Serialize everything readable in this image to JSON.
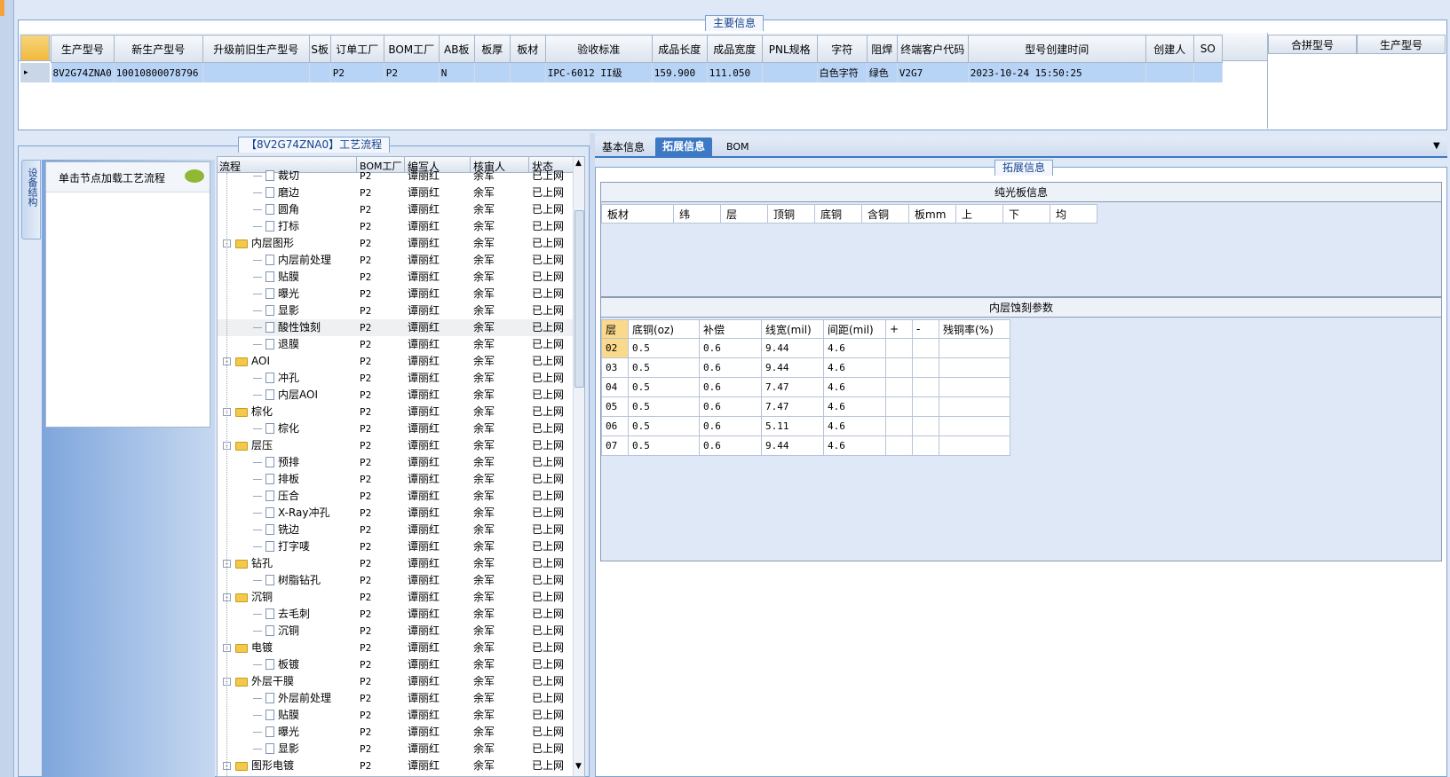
{
  "main_info": {
    "title": "主要信息",
    "columns": [
      "生产型号",
      "新生产型号",
      "升级前旧生产型号",
      "S板",
      "订单工厂",
      "BOM工厂",
      "AB板",
      "板厚",
      "板材",
      "验收标准",
      "成品长度",
      "成品宽度",
      "PNL规格",
      "字符",
      "阻焊",
      "终端客户代码",
      "型号创建时间",
      "创建人",
      "SO"
    ],
    "row": [
      "8V2G74ZNA0",
      "10010800078796",
      "",
      "",
      "P2",
      "P2",
      "N",
      "",
      "",
      "IPC-6012 II级",
      "159.900",
      "111.050",
      "",
      "白色字符",
      "绿色",
      "V2G7",
      "2023-10-24 15:50:25",
      "",
      ""
    ],
    "side_columns": [
      "合拼型号",
      "生产型号"
    ]
  },
  "process": {
    "title": "【8V2G74ZNA0】工艺流程",
    "side_tab": "设备结构",
    "hint": "单击节点加载工艺流程",
    "columns": [
      "流程",
      "BOM工厂",
      "编写人",
      "核审人",
      "状态"
    ],
    "rows": [
      {
        "name": "裁切",
        "type": "doc",
        "factory": "P2",
        "writer": "谭丽红",
        "reviewer": "余军",
        "status": "已上网"
      },
      {
        "name": "磨边",
        "type": "doc",
        "factory": "P2",
        "writer": "谭丽红",
        "reviewer": "余军",
        "status": "已上网"
      },
      {
        "name": "圆角",
        "type": "doc",
        "factory": "P2",
        "writer": "谭丽红",
        "reviewer": "余军",
        "status": "已上网"
      },
      {
        "name": "打标",
        "type": "doc",
        "factory": "P2",
        "writer": "谭丽红",
        "reviewer": "余军",
        "status": "已上网"
      },
      {
        "name": "内层图形",
        "type": "folder",
        "factory": "P2",
        "writer": "谭丽红",
        "reviewer": "余军",
        "status": "已上网"
      },
      {
        "name": "内层前处理",
        "type": "doc",
        "factory": "P2",
        "writer": "谭丽红",
        "reviewer": "余军",
        "status": "已上网"
      },
      {
        "name": "贴膜",
        "type": "doc",
        "factory": "P2",
        "writer": "谭丽红",
        "reviewer": "余军",
        "status": "已上网"
      },
      {
        "name": "曝光",
        "type": "doc",
        "factory": "P2",
        "writer": "谭丽红",
        "reviewer": "余军",
        "status": "已上网"
      },
      {
        "name": "显影",
        "type": "doc",
        "factory": "P2",
        "writer": "谭丽红",
        "reviewer": "余军",
        "status": "已上网"
      },
      {
        "name": "酸性蚀刻",
        "type": "doc",
        "factory": "P2",
        "writer": "谭丽红",
        "reviewer": "余军",
        "status": "已上网"
      },
      {
        "name": "退膜",
        "type": "doc",
        "factory": "P2",
        "writer": "谭丽红",
        "reviewer": "余军",
        "status": "已上网"
      },
      {
        "name": "AOI",
        "type": "folder",
        "factory": "P2",
        "writer": "谭丽红",
        "reviewer": "余军",
        "status": "已上网"
      },
      {
        "name": "冲孔",
        "type": "doc",
        "factory": "P2",
        "writer": "谭丽红",
        "reviewer": "余军",
        "status": "已上网"
      },
      {
        "name": "内层AOI",
        "type": "doc",
        "factory": "P2",
        "writer": "谭丽红",
        "reviewer": "余军",
        "status": "已上网"
      },
      {
        "name": "棕化",
        "type": "folder",
        "factory": "P2",
        "writer": "谭丽红",
        "reviewer": "余军",
        "status": "已上网"
      },
      {
        "name": "棕化",
        "type": "doc",
        "factory": "P2",
        "writer": "谭丽红",
        "reviewer": "余军",
        "status": "已上网"
      },
      {
        "name": "层压",
        "type": "folder",
        "factory": "P2",
        "writer": "谭丽红",
        "reviewer": "余军",
        "status": "已上网"
      },
      {
        "name": "预排",
        "type": "doc",
        "factory": "P2",
        "writer": "谭丽红",
        "reviewer": "余军",
        "status": "已上网"
      },
      {
        "name": "排板",
        "type": "doc",
        "factory": "P2",
        "writer": "谭丽红",
        "reviewer": "余军",
        "status": "已上网"
      },
      {
        "name": "压合",
        "type": "doc",
        "factory": "P2",
        "writer": "谭丽红",
        "reviewer": "余军",
        "status": "已上网"
      },
      {
        "name": "X-Ray冲孔",
        "type": "doc",
        "factory": "P2",
        "writer": "谭丽红",
        "reviewer": "余军",
        "status": "已上网"
      },
      {
        "name": "铣边",
        "type": "doc",
        "factory": "P2",
        "writer": "谭丽红",
        "reviewer": "余军",
        "status": "已上网"
      },
      {
        "name": "打字唛",
        "type": "doc",
        "factory": "P2",
        "writer": "谭丽红",
        "reviewer": "余军",
        "status": "已上网"
      },
      {
        "name": "钻孔",
        "type": "folder",
        "factory": "P2",
        "writer": "谭丽红",
        "reviewer": "余军",
        "status": "已上网"
      },
      {
        "name": "树脂钻孔",
        "type": "doc",
        "factory": "P2",
        "writer": "谭丽红",
        "reviewer": "余军",
        "status": "已上网"
      },
      {
        "name": "沉铜",
        "type": "folder",
        "factory": "P2",
        "writer": "谭丽红",
        "reviewer": "余军",
        "status": "已上网"
      },
      {
        "name": "去毛刺",
        "type": "doc",
        "factory": "P2",
        "writer": "谭丽红",
        "reviewer": "余军",
        "status": "已上网"
      },
      {
        "name": "沉铜",
        "type": "doc",
        "factory": "P2",
        "writer": "谭丽红",
        "reviewer": "余军",
        "status": "已上网"
      },
      {
        "name": "电镀",
        "type": "folder",
        "factory": "P2",
        "writer": "谭丽红",
        "reviewer": "余军",
        "status": "已上网"
      },
      {
        "name": "板镀",
        "type": "doc",
        "factory": "P2",
        "writer": "谭丽红",
        "reviewer": "余军",
        "status": "已上网"
      },
      {
        "name": "外层干膜",
        "type": "folder",
        "factory": "P2",
        "writer": "谭丽红",
        "reviewer": "余军",
        "status": "已上网"
      },
      {
        "name": "外层前处理",
        "type": "doc",
        "factory": "P2",
        "writer": "谭丽红",
        "reviewer": "余军",
        "status": "已上网"
      },
      {
        "name": "贴膜",
        "type": "doc",
        "factory": "P2",
        "writer": "谭丽红",
        "reviewer": "余军",
        "status": "已上网"
      },
      {
        "name": "曝光",
        "type": "doc",
        "factory": "P2",
        "writer": "谭丽红",
        "reviewer": "余军",
        "status": "已上网"
      },
      {
        "name": "显影",
        "type": "doc",
        "factory": "P2",
        "writer": "谭丽红",
        "reviewer": "余军",
        "status": "已上网"
      },
      {
        "name": "图形电镀",
        "type": "folder",
        "factory": "P2",
        "writer": "谭丽红",
        "reviewer": "余军",
        "status": "已上网"
      }
    ]
  },
  "tabs": [
    "基本信息",
    "拓展信息",
    "BOM"
  ],
  "active_tab": 1,
  "ext": {
    "title": "拓展信息",
    "bare_board_title": "纯光板信息",
    "bare_board_columns": [
      "板材",
      "纬",
      "层",
      "顶铜",
      "底铜",
      "含铜",
      "板mm",
      "上",
      "下",
      "均"
    ],
    "etch_title": "内层蚀刻参数",
    "etch_columns": [
      "层",
      "底铜(oz)",
      "补偿",
      "线宽(mil)",
      "间距(mil)",
      "+",
      "-",
      "残铜率(%)"
    ],
    "etch_rows": [
      [
        "02",
        "0.5",
        "0.6",
        "9.44",
        "4.6",
        "",
        "",
        ""
      ],
      [
        "03",
        "0.5",
        "0.6",
        "9.44",
        "4.6",
        "",
        "",
        ""
      ],
      [
        "04",
        "0.5",
        "0.6",
        "7.47",
        "4.6",
        "",
        "",
        ""
      ],
      [
        "05",
        "0.5",
        "0.6",
        "7.47",
        "4.6",
        "",
        "",
        ""
      ],
      [
        "06",
        "0.5",
        "0.6",
        "5.11",
        "4.6",
        "",
        "",
        ""
      ],
      [
        "07",
        "0.5",
        "0.6",
        "9.44",
        "4.6",
        "",
        "",
        ""
      ]
    ]
  },
  "colors": {
    "selected_row": "#b7d3f5",
    "accent": "#15428b",
    "active_tab": "#3d78c4",
    "highlight_cell": "#fbd98b"
  }
}
